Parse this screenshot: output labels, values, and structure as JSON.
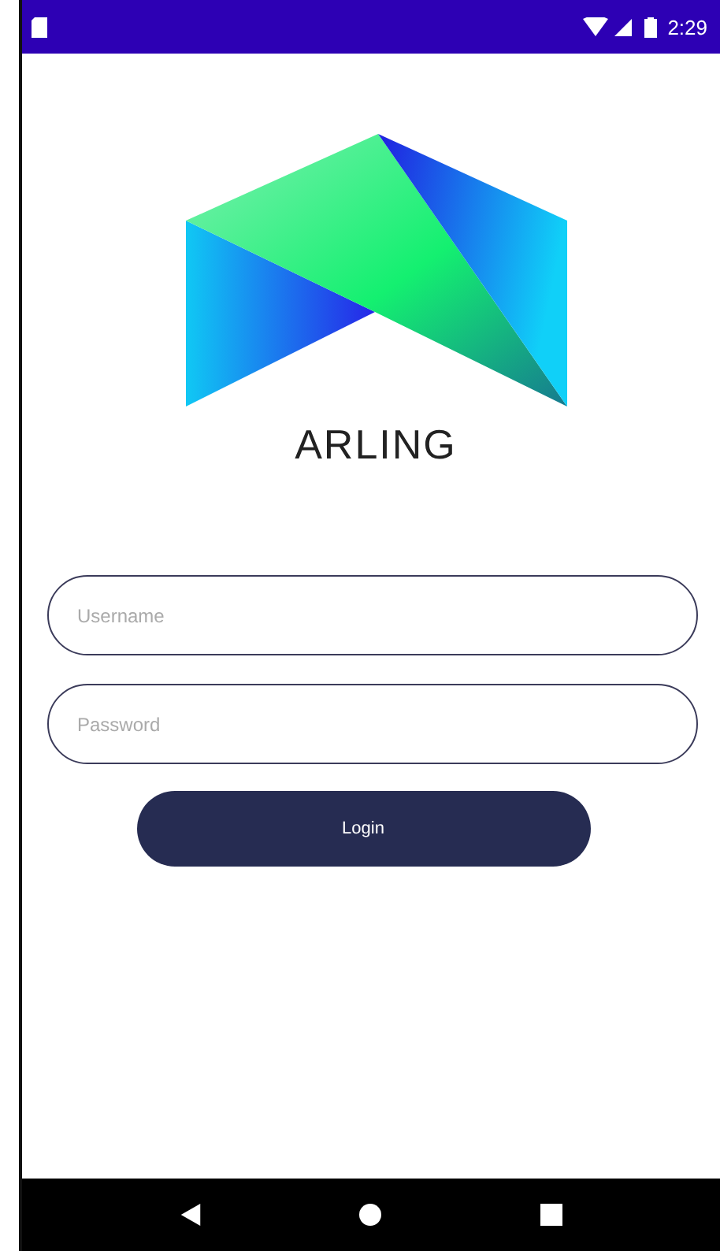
{
  "status_bar": {
    "time": "2:29"
  },
  "logo": {
    "name": "ARLING"
  },
  "fields": [
    {
      "placeholder": "Username"
    },
    {
      "placeholder": "Password"
    }
  ],
  "login_button": {
    "label": "Login"
  }
}
